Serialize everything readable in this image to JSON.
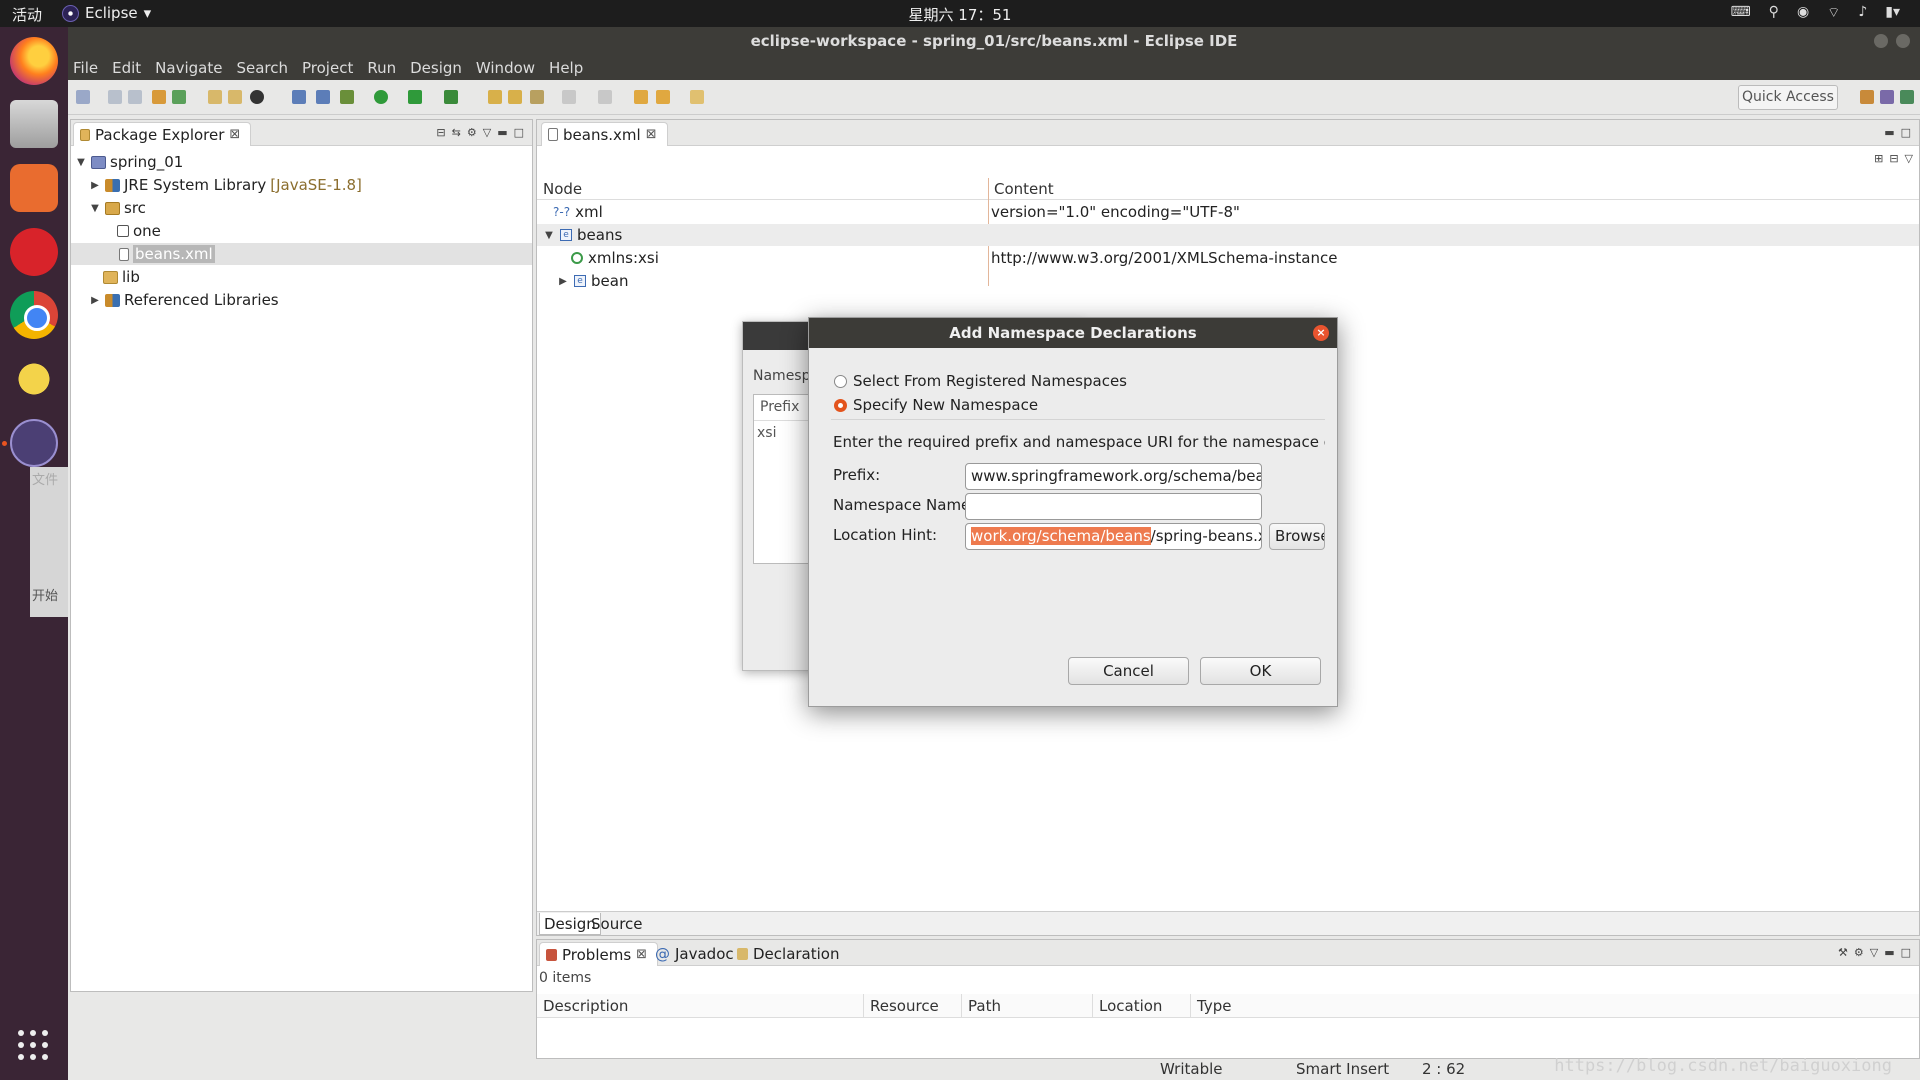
{
  "topbar": {
    "activities": "活动",
    "app_name": "Eclipse",
    "clock": "星期六 17：51"
  },
  "window": {
    "title": "eclipse-workspace - spring_01/src/beans.xml - Eclipse IDE"
  },
  "menu": [
    "File",
    "Edit",
    "Navigate",
    "Search",
    "Project",
    "Run",
    "Design",
    "Window",
    "Help"
  ],
  "toolbar": {
    "quick_access": "Quick Access"
  },
  "launcher": {
    "ghost_text_1": "文件",
    "ghost_text_2": "开始"
  },
  "package_explorer": {
    "tab_label": "Package Explorer",
    "tree": [
      {
        "label": "spring_01",
        "suffix": ""
      },
      {
        "label": "JRE System Library",
        "suffix": "[JavaSE-1.8]"
      },
      {
        "label": "src",
        "suffix": ""
      },
      {
        "label": "one",
        "suffix": ""
      },
      {
        "label": "beans.xml",
        "suffix": ""
      },
      {
        "label": "lib",
        "suffix": ""
      },
      {
        "label": "Referenced Libraries",
        "suffix": ""
      }
    ]
  },
  "editor": {
    "tab_label": "beans.xml",
    "col_node": "Node",
    "col_content": "Content",
    "rows": [
      {
        "node": "xml",
        "prefix": "?-?",
        "content": "version=\"1.0\" encoding=\"UTF-8\""
      },
      {
        "node": "beans",
        "prefix": "e",
        "content": ""
      },
      {
        "node": "xmlns:xsi",
        "prefix": "",
        "content": "http://www.w3.org/2001/XMLSchema-instance"
      },
      {
        "node": "bean",
        "prefix": "e",
        "content": ""
      }
    ],
    "bottom_tab_design": "Design",
    "bottom_tab_source": "Source"
  },
  "problems": {
    "tab_problems": "Problems",
    "tab_javadoc": "Javadoc",
    "tab_declaration": "Declaration",
    "count": "0 items",
    "columns": [
      "Description",
      "Resource",
      "Path",
      "Location",
      "Type"
    ]
  },
  "status": {
    "writable": "Writable",
    "insert_mode": "Smart Insert",
    "position": "2 : 62"
  },
  "watermark": "https://blog.csdn.net/baiguoxiong",
  "bg_dialog": {
    "label": "Namesp",
    "col_prefix": "Prefix",
    "row": "xsi"
  },
  "dialog": {
    "title": "Add Namespace Declarations",
    "close_glyph": "×",
    "radio_registered": "Select From Registered Namespaces",
    "radio_new": "Specify New Namespace",
    "instruction": "Enter the required prefix and namespace URI for the namespace declarat",
    "prefix_label": "Prefix:",
    "prefix_value": "www.springframework.org/schema/beans",
    "ns_label": "Namespace Name:",
    "ns_value": "",
    "hint_label": "Location Hint:",
    "hint_value_selected": "work.org/schema/beans",
    "hint_value_rest": "/spring-beans.xsd",
    "browse_label": "Browse",
    "cancel_label": "Cancel",
    "ok_label": "OK"
  },
  "colors": {
    "accent": "#e3541d",
    "titlebar": "#3c3b37",
    "launcher": "#3a2535"
  }
}
